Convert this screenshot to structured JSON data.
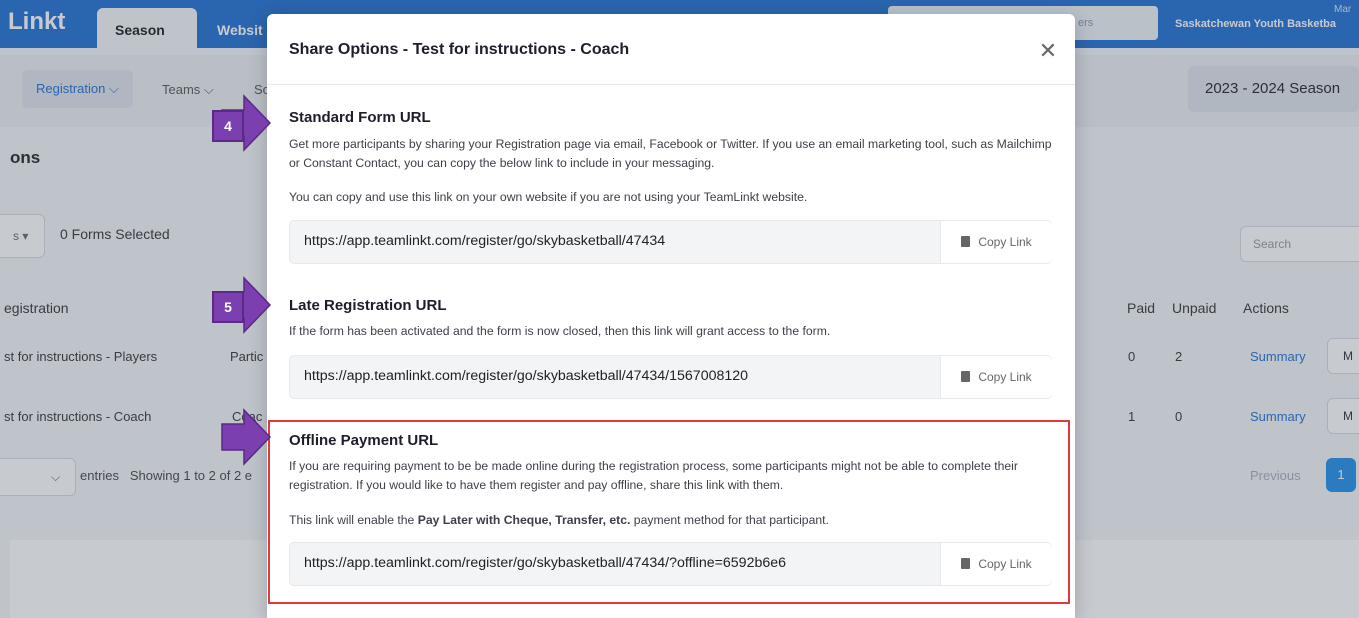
{
  "app": {
    "logo": "Linkt",
    "tabs": [
      "Season",
      "Websit"
    ],
    "top_search_placeholder": "ers",
    "org_name": "Saskatchewan Youth Basketba",
    "user_name": "Mar"
  },
  "subnav": {
    "registration": "Registration ⌵",
    "teams": "Teams ⌵",
    "sc": "Sc",
    "season": "2023 - 2024 Season"
  },
  "background": {
    "page_title": "ons",
    "select_label": "s ▾",
    "forms_selected": "0 Forms Selected",
    "search_placeholder": "Search",
    "columns": {
      "registration": "egistration",
      "paid": "Paid",
      "unpaid": "Unpaid",
      "actions": "Actions"
    },
    "rows": [
      {
        "name": "st for instructions - Players",
        "type": "Partic",
        "paid": "0",
        "unpaid": "2",
        "action": "Summary",
        "more": "M"
      },
      {
        "name": "st for instructions - Coach",
        "type": "Coac",
        "paid": "1",
        "unpaid": "0",
        "action": "Summary",
        "more": "M"
      }
    ],
    "entries_label": "entries",
    "showing": "Showing 1 to 2 of 2 e",
    "previous": "Previous",
    "page": "1"
  },
  "modal": {
    "title": "Share Options - Test for instructions - Coach",
    "close_icon": "close-icon",
    "copy_label": "Copy Link",
    "standard": {
      "heading": "Standard Form URL",
      "text1": "Get more participants by sharing your Registration page via email, Facebook or Twitter. If you use an email marketing tool, such as Mailchimp or Constant Contact, you can copy the below link to include in your messaging.",
      "text2": "You can copy and use this link on your own website if you are not using your TeamLinkt website.",
      "url": "https://app.teamlinkt.com/register/go/skybasketball/47434"
    },
    "late": {
      "heading": "Late Registration URL",
      "text": "If the form has been activated and the form is now closed, then this link will grant access to the form.",
      "url": "https://app.teamlinkt.com/register/go/skybasketball/47434/1567008120"
    },
    "offline": {
      "heading": "Offline Payment URL",
      "text1": "If you are requiring payment to be be made online during the registration process, some participants might not be able to complete their registration. If you would like to have them register and pay offline, share this link with them.",
      "text2_prefix": "This link will enable the ",
      "text2_bold": "Pay Later with Cheque, Transfer, etc.",
      "text2_suffix": " payment method for that participant.",
      "url": "https://app.teamlinkt.com/register/go/skybasketball/47434/?offline=6592b6e6"
    }
  },
  "annotations": {
    "badge4": "4",
    "badge5": "5",
    "arrow_color": "#7b3fb0",
    "highlight_color": "#e03a3e"
  }
}
